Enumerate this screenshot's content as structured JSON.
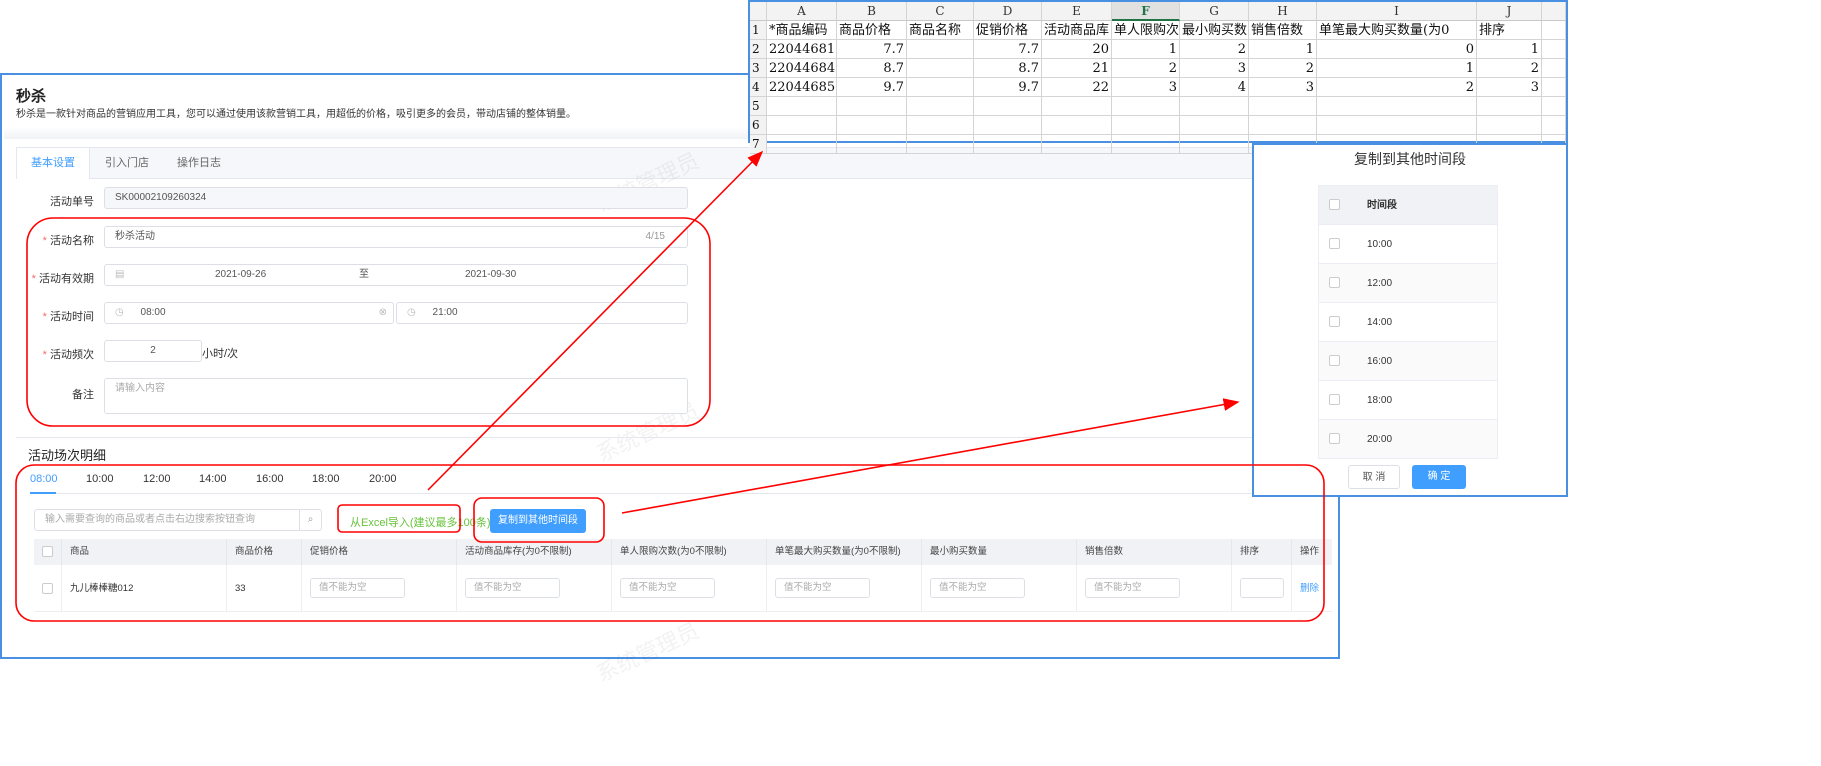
{
  "page": {
    "title": "秒杀",
    "description": "秒杀是一款针对商品的营销应用工具，您可以通过使用该款营销工具，用超低的价格，吸引更多的会员，带动店铺的整体销量。",
    "watermark": "系统管理员"
  },
  "tabs": [
    "基本设置",
    "引入门店",
    "操作日志"
  ],
  "form": {
    "order_no_label": "活动单号",
    "order_no": "SK00002109260324",
    "name_label": "活动名称",
    "name": "秒杀活动",
    "name_count": "4/15",
    "period_label": "活动有效期",
    "start_date": "2021-09-26",
    "to": "至",
    "end_date": "2021-09-30",
    "time_label": "活动时间",
    "start_time": "08:00",
    "end_time": "21:00",
    "freq_label": "活动频次",
    "freq": "2",
    "freq_unit": "小时/次",
    "remark_label": "备注",
    "remark_placeholder": "请输入内容"
  },
  "detail": {
    "title": "活动场次明细",
    "time_tabs": [
      "08:00",
      "10:00",
      "12:00",
      "14:00",
      "16:00",
      "18:00",
      "20:00"
    ],
    "search_placeholder": "输入需要查询的商品或者点击右边搜索按钮查询",
    "import_label": "从Excel导入(建议最多100条)",
    "copy_button": "复制到其他时间段",
    "columns": [
      "商品",
      "商品价格",
      "促销价格",
      "活动商品库存(为0不限制)",
      "单人限购次数(为0不限制)",
      "单笔最大购买数量(为0不限制)",
      "最小购买数量",
      "销售倍数",
      "排序",
      "操作"
    ],
    "row": {
      "product": "九儿棒棒糖012",
      "price": "33",
      "placeholder": "值不能为空",
      "action": "删除"
    }
  },
  "excel": {
    "col_letters": [
      "A",
      "B",
      "C",
      "D",
      "E",
      "F",
      "G",
      "H",
      "I",
      "J"
    ],
    "row_nums": [
      "1",
      "2",
      "3",
      "4",
      "5",
      "6",
      "7"
    ],
    "header": [
      "*商品编码",
      "商品价格",
      "商品名称",
      "促销价格",
      "活动商品库",
      "单人限购次",
      "最小购买数",
      "销售倍数",
      "单笔最大购买数量(为0",
      "排序"
    ],
    "rows": [
      [
        "22044681",
        "7.7",
        "",
        "7.7",
        "20",
        "1",
        "2",
        "1",
        "0",
        "1"
      ],
      [
        "22044684",
        "8.7",
        "",
        "8.7",
        "21",
        "2",
        "3",
        "2",
        "1",
        "2"
      ],
      [
        "22044685",
        "9.7",
        "",
        "9.7",
        "22",
        "3",
        "4",
        "3",
        "2",
        "3"
      ]
    ]
  },
  "dialog": {
    "title": "复制到其他时间段",
    "col": "时间段",
    "times": [
      "10:00",
      "12:00",
      "14:00",
      "16:00",
      "18:00",
      "20:00"
    ],
    "cancel": "取 消",
    "ok": "确 定"
  },
  "colors": {
    "primary": "#409eff",
    "annotation": "#ff0000",
    "import": "#67c23a"
  }
}
